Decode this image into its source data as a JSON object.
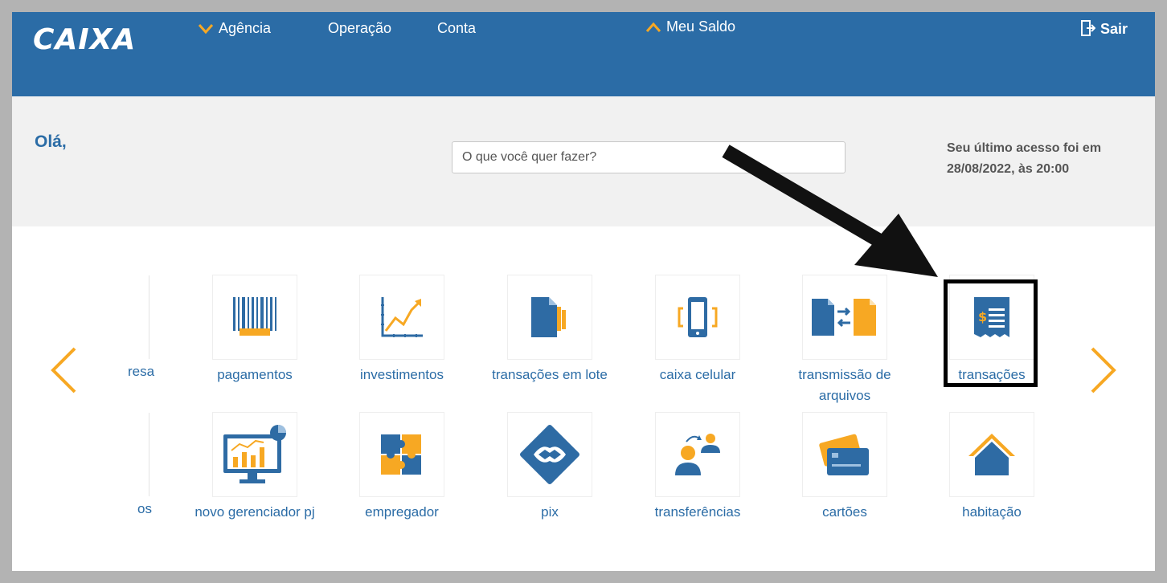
{
  "header": {
    "logo": "CAIXA",
    "nav": {
      "agencia": "Agência",
      "operacao": "Operação",
      "conta": "Conta",
      "saldo": "Meu Saldo"
    },
    "logout": "Sair"
  },
  "welcome": {
    "greeting": "Olá,",
    "search_placeholder": "O que você quer fazer?",
    "last_access_line1": "Seu último acesso foi em",
    "last_access_line2": "28/08/2022, às 20:00"
  },
  "grid": {
    "row1_partial": "resa",
    "row2_partial": "os",
    "row1": [
      {
        "label": "pagamentos",
        "icon": "barcode-icon"
      },
      {
        "label": "investimentos",
        "icon": "chart-up-icon"
      },
      {
        "label": "transações em lote",
        "icon": "document-batch-icon"
      },
      {
        "label": "caixa celular",
        "icon": "mobile-phone-icon"
      },
      {
        "label": "transmissão de arquivos",
        "icon": "file-transfer-icon"
      },
      {
        "label": "transações",
        "icon": "receipt-icon"
      }
    ],
    "row2": [
      {
        "label": "novo gerenciador pj",
        "icon": "monitor-chart-icon"
      },
      {
        "label": "empregador",
        "icon": "puzzle-icon"
      },
      {
        "label": "pix",
        "icon": "pix-icon"
      },
      {
        "label": "transferências",
        "icon": "people-transfer-icon"
      },
      {
        "label": "cartões",
        "icon": "cards-icon"
      },
      {
        "label": "habitação",
        "icon": "house-icon"
      }
    ]
  },
  "colors": {
    "brand_blue": "#2b6ca6",
    "accent_orange": "#f7a823",
    "icon_blue": "#2e6ba4"
  }
}
